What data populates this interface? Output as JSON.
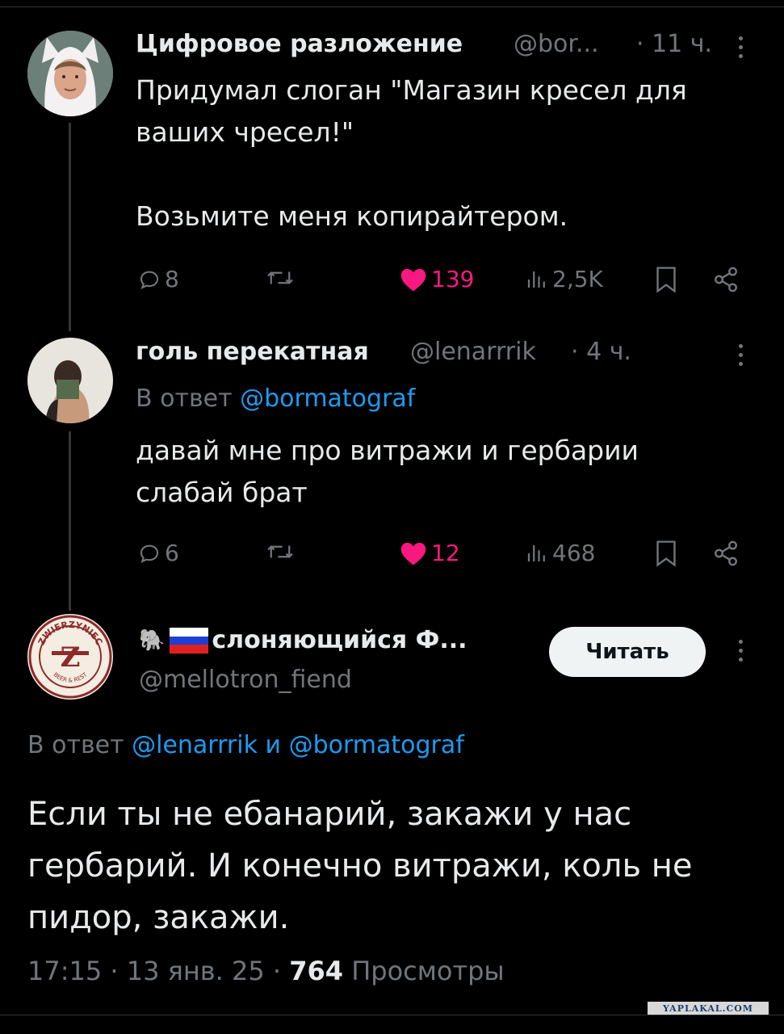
{
  "colors": {
    "background": "#000000",
    "text": "#e7e9ea",
    "muted": "#71767b",
    "link": "#1d9bf0",
    "like": "#f91880",
    "button_bg": "#eff3f4"
  },
  "tweet1": {
    "name": "Цифровое разложение",
    "handle": "@bor...",
    "time": "· 11 ч.",
    "text_line1": "Придумал слоган \"Магазин кресел для",
    "text_line2": "ваших чресел!\"",
    "text_line3": "Возьмите меня копирайтером.",
    "replies": "8",
    "likes": "139",
    "views": "2,5K"
  },
  "tweet2": {
    "name": "голь перекатная",
    "handle": "@lenarrrik",
    "time": "· 4 ч.",
    "reply_prefix": "В ответ",
    "reply_mention": "@bormatograf",
    "text_line1": "давай мне про витражи и гербарии",
    "text_line2": "слабай брат",
    "replies": "6",
    "likes": "12",
    "views": "468"
  },
  "main_tweet": {
    "emoji": "🐘",
    "name": "слоняющийся Ф...",
    "handle": "@mellotron_fiend",
    "follow_label": "Читать",
    "reply_prefix": "В ответ",
    "reply_mention1": "@lenarrrik",
    "reply_and": "и",
    "reply_mention2": "@bormatograf",
    "text_line1": "Если ты не ебанарий, закажи у нас",
    "text_line2": "гербарий. И конечно витражи, коль не",
    "text_line3": "пидор, закажи.",
    "timestamp": "17:15 · 13 янв. 25 ·",
    "views_count": "764",
    "views_label": "Просмотры",
    "avatar_logo_top": "ZWIERZYNIEC",
    "avatar_logo_letter": "Z",
    "avatar_logo_bottom": "BEER & REST"
  },
  "watermark": "YAPLAKAL.COM",
  "icons": {
    "reply": "reply-icon",
    "retweet": "retweet-icon",
    "like": "heart-icon",
    "views": "views-icon",
    "bookmark": "bookmark-icon",
    "share": "share-icon",
    "more": "more-icon"
  }
}
